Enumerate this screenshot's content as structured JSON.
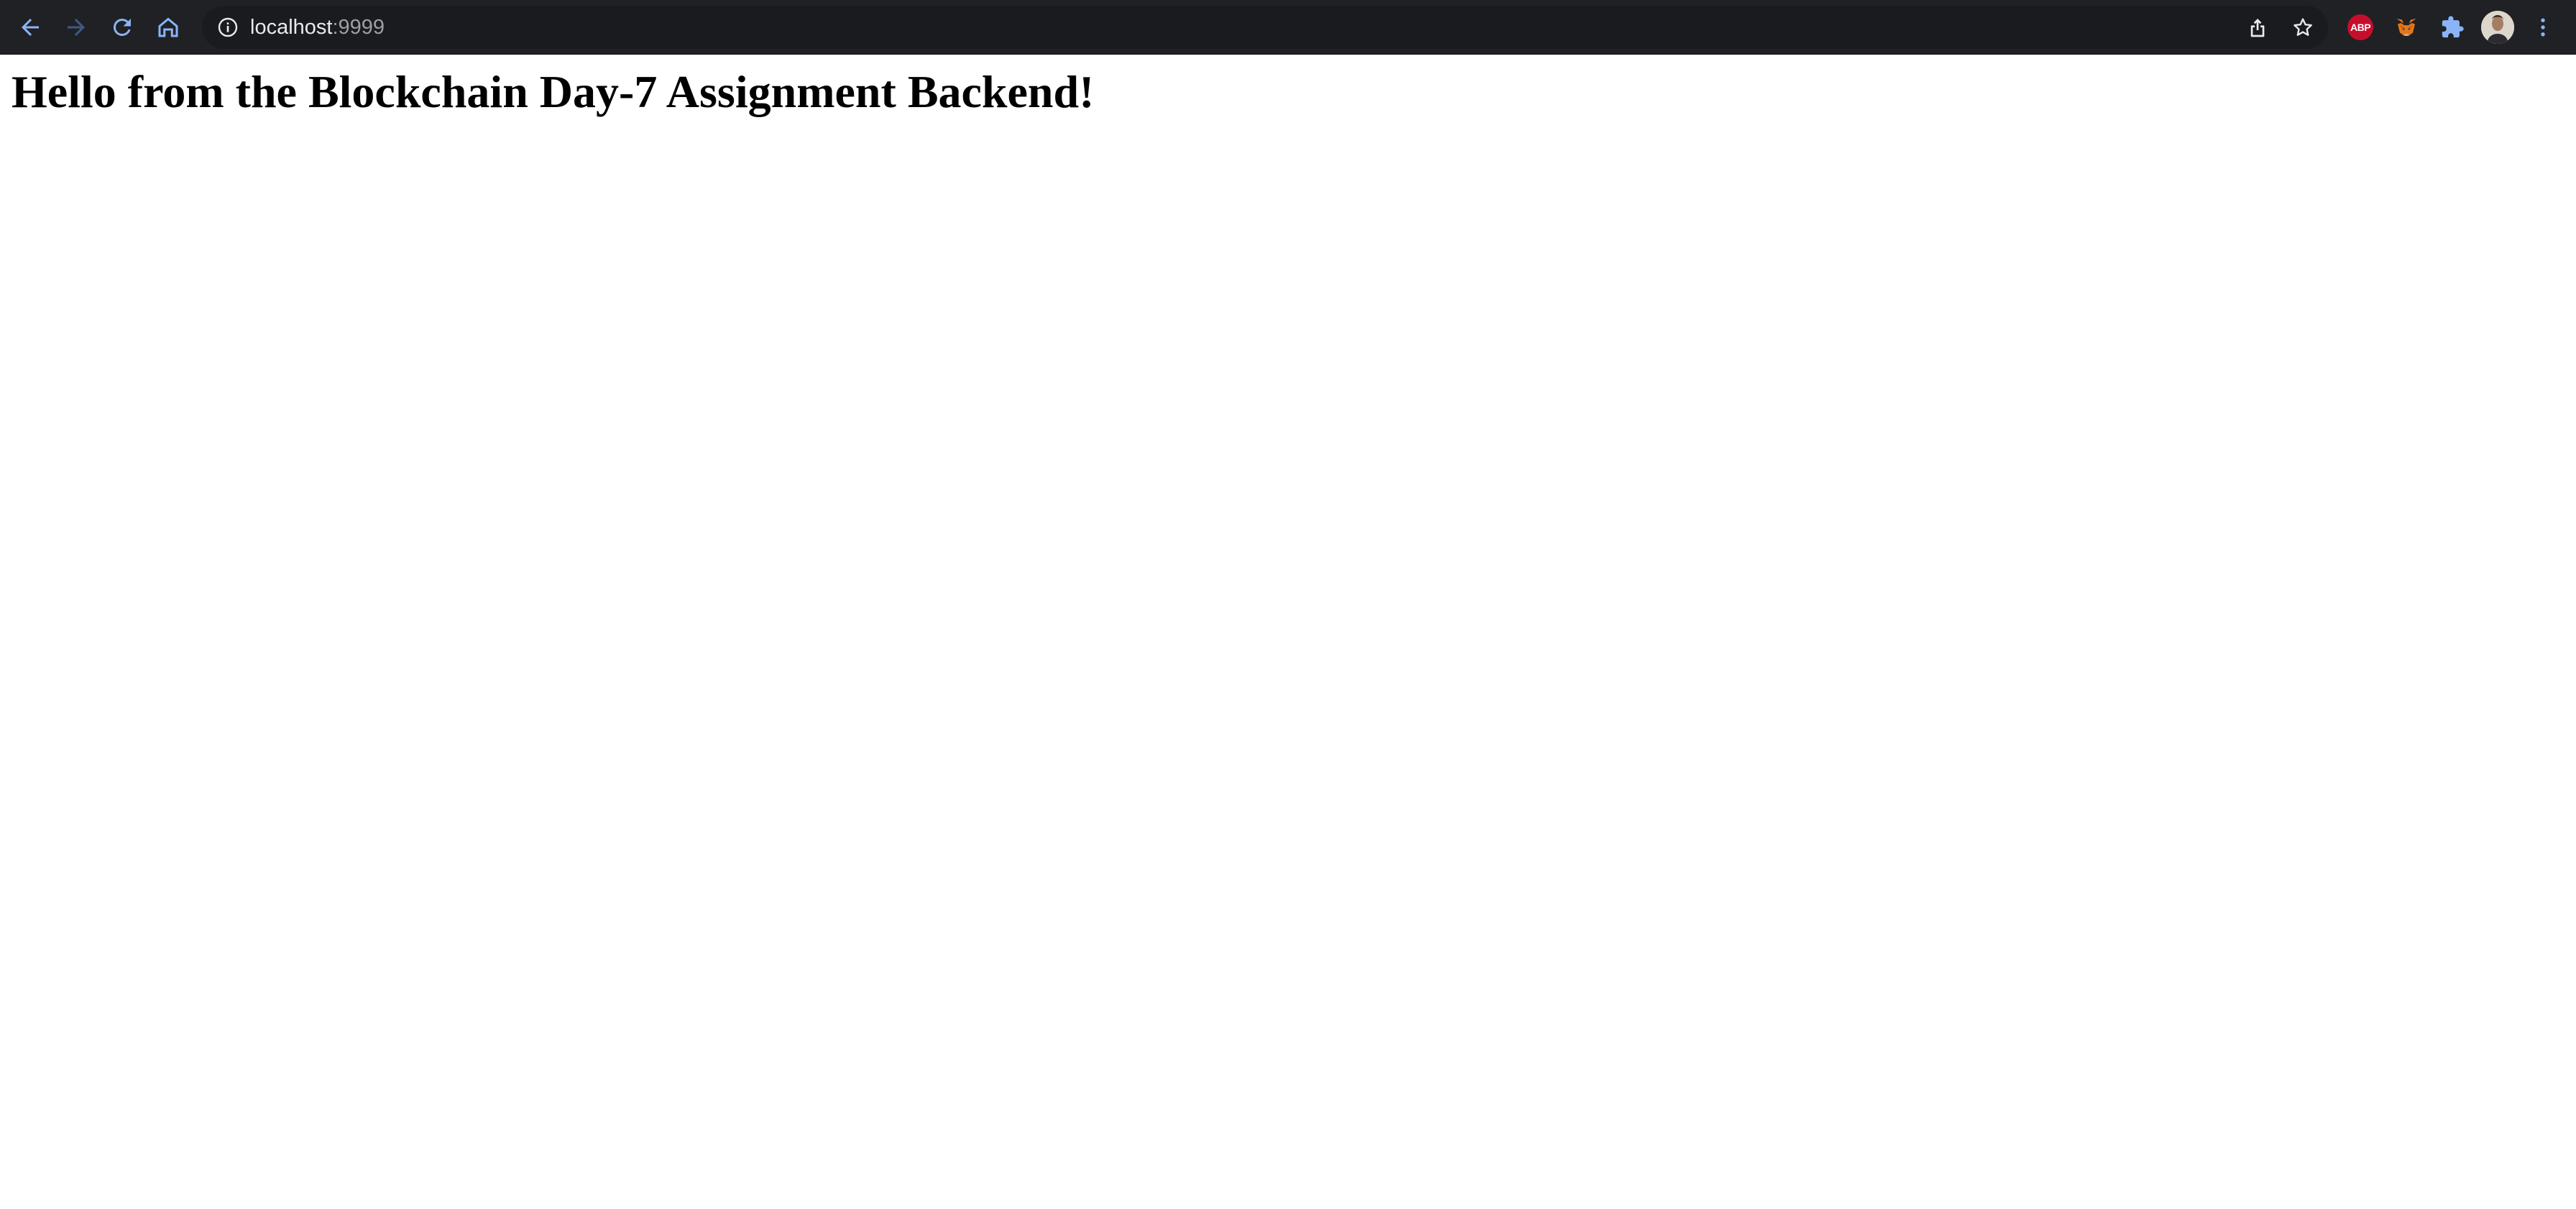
{
  "browser": {
    "url_host": "localhost",
    "url_port": ":9999",
    "icons": {
      "back": "arrow-left-icon",
      "forward": "arrow-right-icon",
      "reload": "reload-icon",
      "home": "home-icon",
      "site_info": "info-icon",
      "share": "share-icon",
      "bookmark": "star-icon",
      "extensions": "puzzle-icon",
      "menu": "kebab-menu-icon"
    },
    "extensions": {
      "abp_label": "ABP"
    },
    "colors": {
      "toolbar_bg": "#202124",
      "nav_active": "#8ab4f8",
      "nav_disabled": "#3c5a86",
      "abp_red": "#c70d2c",
      "metamask_orange": "#e2761b",
      "puzzle_blue": "#8ab4f8"
    }
  },
  "page": {
    "heading": "Hello from the Blockchain Day-7 Assignment Backend!"
  }
}
